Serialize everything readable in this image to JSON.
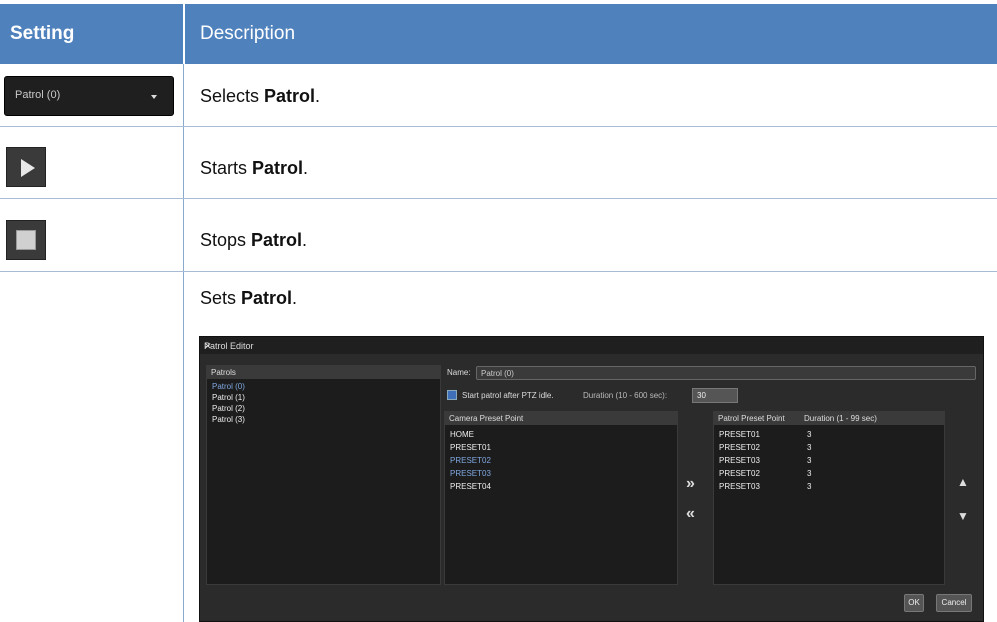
{
  "header": {
    "setting": "Setting",
    "description": "Description"
  },
  "rows": [
    {
      "pre": "Selects ",
      "bold": "Patrol",
      "post": "."
    },
    {
      "pre": "Starts ",
      "bold": "Patrol",
      "post": "."
    },
    {
      "pre": "Stops ",
      "bold": "Patrol",
      "post": "."
    },
    {
      "pre": "Sets ",
      "bold": "Patrol",
      "post": "."
    }
  ],
  "dropdown": {
    "value": "Patrol (0)"
  },
  "icons": {
    "play": "play-icon",
    "stop": "stop-icon"
  },
  "editor": {
    "title": "Patrol Editor",
    "patrols_header": "Patrols",
    "patrols": [
      "Patrol (0)",
      "Patrol (1)",
      "Patrol (2)",
      "Patrol (3)"
    ],
    "name_label": "Name:",
    "name_value": "Patrol (0)",
    "start_label": "Start patrol after PTZ idle.",
    "duration_label": "Duration (10 - 600 sec):",
    "duration_value": "30",
    "camera_header": "Camera Preset Point",
    "camera_presets": [
      "HOME",
      "PRESET01",
      "PRESET02",
      "PRESET03",
      "PRESET04"
    ],
    "patrol_header": "Patrol Preset Point",
    "patrol_duration_header": "Duration (1 - 99 sec)",
    "patrol_presets": [
      {
        "name": "PRESET01",
        "duration": "3"
      },
      {
        "name": "PRESET02",
        "duration": "3"
      },
      {
        "name": "PRESET03",
        "duration": "3"
      },
      {
        "name": "PRESET02",
        "duration": "3"
      },
      {
        "name": "PRESET03",
        "duration": "3"
      }
    ],
    "ok": "OK",
    "cancel": "Cancel"
  },
  "colors": {
    "header_bg": "#4f81bd",
    "header_text": "#ffffff",
    "grid": "#a9bcd6"
  }
}
